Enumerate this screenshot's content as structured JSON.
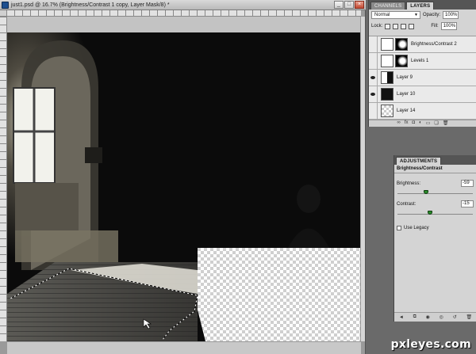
{
  "document": {
    "title": "just1.psd @ 16.7% (Brightness/Contrast 1 copy, Layer Mask/8) *",
    "window_buttons": [
      "_",
      "□",
      "×"
    ]
  },
  "layers_panel": {
    "tabs": [
      "CHANNELS",
      "LAYERS"
    ],
    "active_tab": "LAYERS",
    "blend_mode": "Normal",
    "opacity_label": "Opacity:",
    "opacity_value": "100%",
    "lock_label": "Lock:",
    "fill_label": "Fill:",
    "fill_value": "100%",
    "layers": [
      {
        "name": "Brightness/Contrast 2",
        "visible": false
      },
      {
        "name": "Levels 1",
        "visible": false
      },
      {
        "name": "Layer 9",
        "visible": true
      },
      {
        "name": "Layer 10",
        "visible": true
      },
      {
        "name": "Layer 14",
        "visible": false
      }
    ],
    "footer_icons": [
      "link-icon",
      "fx-icon",
      "mask-icon",
      "adjustment-icon",
      "folder-icon",
      "new-layer-icon",
      "trash-icon"
    ]
  },
  "adjustments_panel": {
    "tab": "ADJUSTMENTS",
    "title": "Brightness/Contrast",
    "brightness_label": "Brightness:",
    "brightness_value": "-59",
    "brightness_level": 0.35,
    "contrast_label": "Contrast:",
    "contrast_value": "-15",
    "contrast_level": 0.4,
    "legacy_label": "Use Legacy",
    "legacy_checked": false
  },
  "watermark": "pxleyes.com",
  "colors": {
    "canvas_bg": "#0b0b0b",
    "window_light": "#f2f2ec",
    "stone": "#6b675c",
    "slider_green": "#2a8a2a"
  }
}
